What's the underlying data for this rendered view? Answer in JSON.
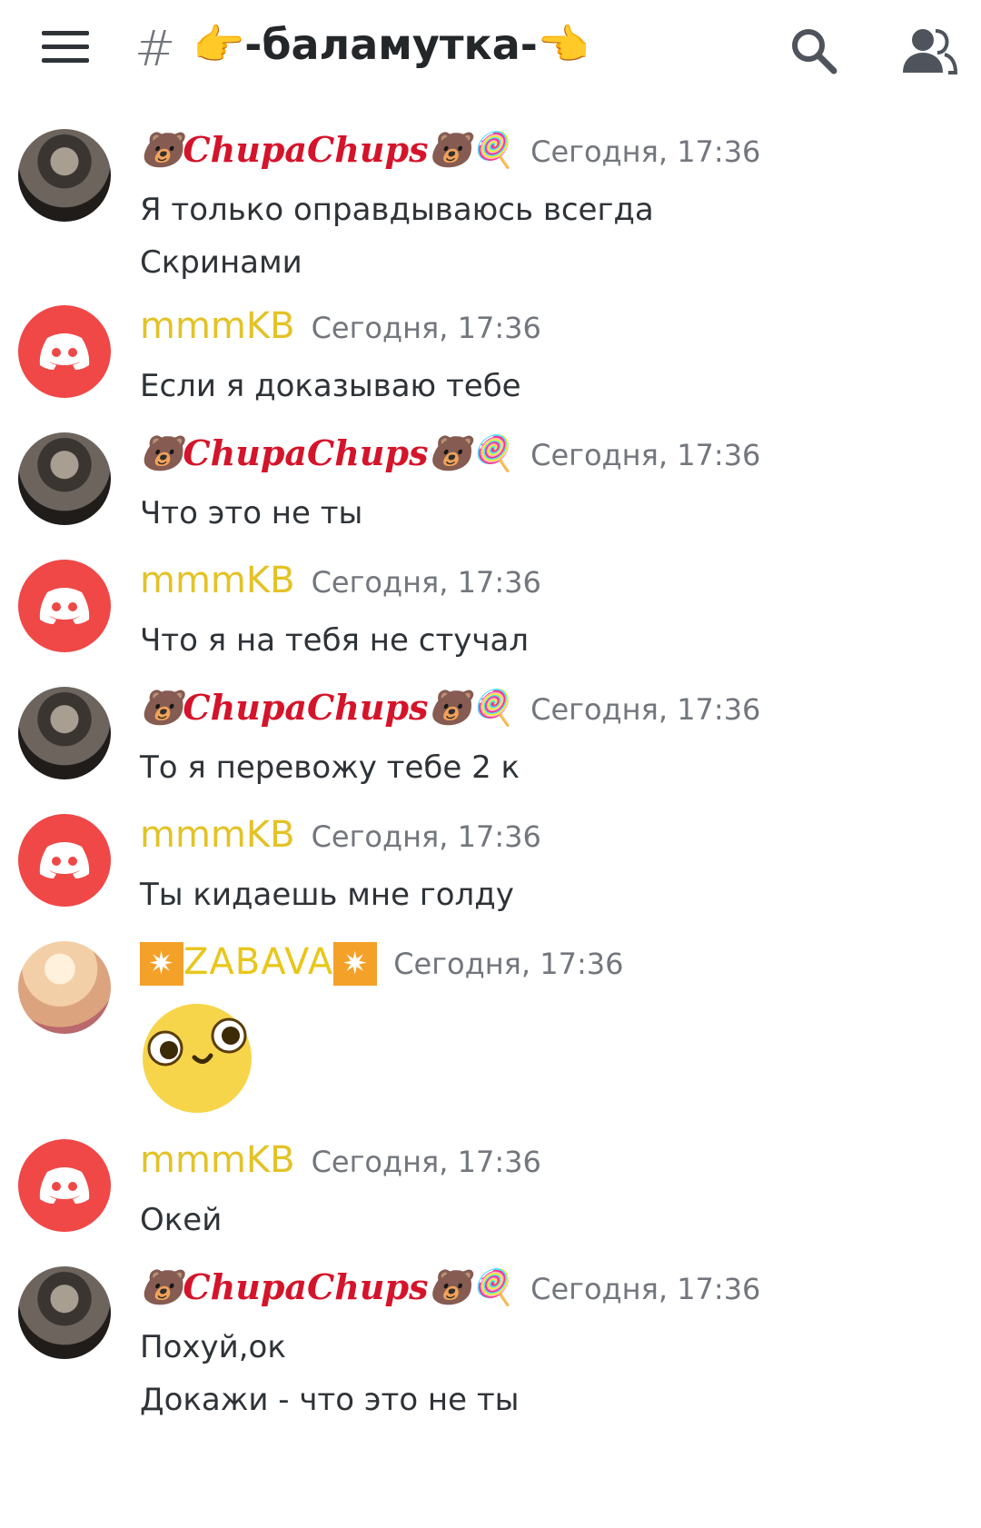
{
  "header": {
    "hash": "#",
    "channel": "👉-баламутка-👈"
  },
  "users": {
    "chupa": "ChupaChups",
    "chupa_prefix": "🐻",
    "chupa_suffix": "🐻🍭",
    "mmm": "mmmKB",
    "zabava": "ZABAVA",
    "zabava_star": "✷"
  },
  "messages": [
    {
      "user": "ChupaChups",
      "time": "Сегодня, 17:36",
      "lines": [
        "Я только оправдываюсь всегда",
        "Скринами"
      ]
    },
    {
      "user": "mmmKB",
      "time": "Сегодня, 17:36",
      "lines": [
        "Если я доказываю тебе"
      ]
    },
    {
      "user": "ChupaChups",
      "time": "Сегодня, 17:36",
      "lines": [
        "Что это не ты"
      ]
    },
    {
      "user": "mmmKB",
      "time": "Сегодня, 17:36",
      "lines": [
        "Что я на тебя не стучал"
      ]
    },
    {
      "user": "ChupaChups",
      "time": "Сегодня, 17:36",
      "lines": [
        "То я перевожу тебе 2 к"
      ]
    },
    {
      "user": "mmmKB",
      "time": "Сегодня, 17:36",
      "lines": [
        "Ты кидаешь мне голду"
      ]
    },
    {
      "user": "ZABAVA",
      "time": "Сегодня, 17:36",
      "lines": []
    },
    {
      "user": "mmmKB",
      "time": "Сегодня, 17:36",
      "lines": [
        "Окей"
      ]
    },
    {
      "user": "ChupaChups",
      "time": "Сегодня, 17:36",
      "lines": [
        "Похуй,ок",
        "Докажи - что это не ты"
      ]
    }
  ],
  "colors": {
    "discord_red": "#f04747",
    "username_yellow": "#e3c226",
    "chupa_red": "#d4142a",
    "timestamp": "#72767d"
  },
  "icons": {
    "menu": "hamburger-icon",
    "search": "search-icon",
    "members": "members-icon",
    "discord": "discord-logo-icon",
    "sticker": "emoji-face-sticker"
  }
}
